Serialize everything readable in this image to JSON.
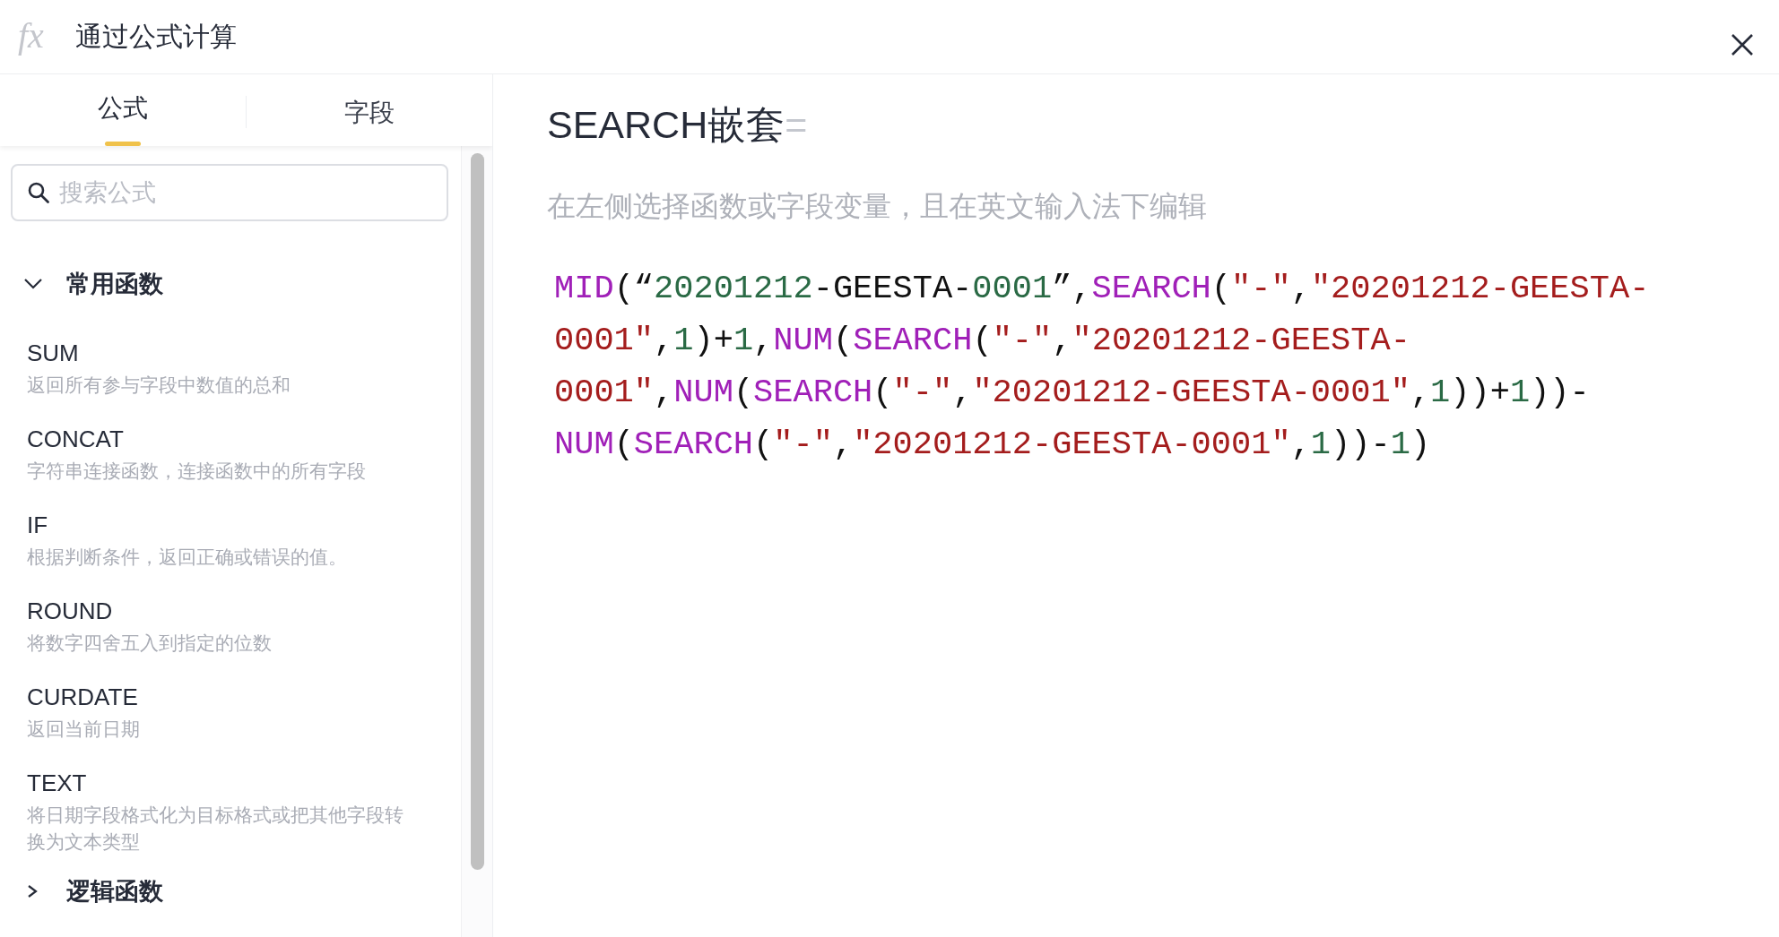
{
  "window": {
    "icon": "fx",
    "title": "通过公式计算"
  },
  "tabs": [
    {
      "label": "公式",
      "selected": true
    },
    {
      "label": "字段",
      "selected": false
    }
  ],
  "search": {
    "placeholder": "搜索公式"
  },
  "groups": [
    {
      "label": "常用函数",
      "expanded": true,
      "items": [
        {
          "name": "SUM",
          "description": "返回所有参与字段中数值的总和"
        },
        {
          "name": "CONCAT",
          "description": "字符串连接函数，连接函数中的所有字段"
        },
        {
          "name": "IF",
          "description": "根据判断条件，返回正确或错误的值。"
        },
        {
          "name": "ROUND",
          "description": "将数字四舍五入到指定的位数"
        },
        {
          "name": "CURDATE",
          "description": "返回当前日期"
        },
        {
          "name": "TEXT",
          "description": "将日期字段格式化为目标格式或把其他字段转换为文本类型"
        }
      ]
    },
    {
      "label": "逻辑函数",
      "expanded": false
    }
  ],
  "editor": {
    "title": "SEARCH嵌套",
    "title_suffix": "=",
    "hint": "在左侧选择函数或字段变量，且在英文输入法下编辑",
    "code_lines": [
      [
        {
          "kind": "fn",
          "text": "MID"
        },
        {
          "kind": "punct",
          "text": "(“"
        },
        {
          "kind": "num",
          "text": "20201212"
        },
        {
          "kind": "punct",
          "text": "-GEESTA-"
        },
        {
          "kind": "num",
          "text": "0001"
        },
        {
          "kind": "punct",
          "text": "”,"
        },
        {
          "kind": "fn",
          "text": "SEARCH"
        },
        {
          "kind": "punct",
          "text": "("
        },
        {
          "kind": "str",
          "text": "\"-\""
        },
        {
          "kind": "punct",
          "text": ","
        },
        {
          "kind": "str",
          "text": "\"20201212-GEESTA-"
        }
      ],
      [
        {
          "kind": "str",
          "text": "0001\""
        },
        {
          "kind": "punct",
          "text": ","
        },
        {
          "kind": "num",
          "text": "1"
        },
        {
          "kind": "punct",
          "text": ")+"
        },
        {
          "kind": "num",
          "text": "1"
        },
        {
          "kind": "punct",
          "text": ","
        },
        {
          "kind": "fn",
          "text": "NUM"
        },
        {
          "kind": "punct",
          "text": "("
        },
        {
          "kind": "fn",
          "text": "SEARCH"
        },
        {
          "kind": "punct",
          "text": "("
        },
        {
          "kind": "str",
          "text": "\"-\""
        },
        {
          "kind": "punct",
          "text": ","
        },
        {
          "kind": "str",
          "text": "\"20201212-GEESTA-"
        }
      ],
      [
        {
          "kind": "str",
          "text": "0001\""
        },
        {
          "kind": "punct",
          "text": ","
        },
        {
          "kind": "fn",
          "text": "NUM"
        },
        {
          "kind": "punct",
          "text": "("
        },
        {
          "kind": "fn",
          "text": "SEARCH"
        },
        {
          "kind": "punct",
          "text": "("
        },
        {
          "kind": "str",
          "text": "\"-\""
        },
        {
          "kind": "punct",
          "text": ","
        },
        {
          "kind": "str",
          "text": "\"20201212-GEESTA-0001\""
        },
        {
          "kind": "punct",
          "text": ","
        },
        {
          "kind": "num",
          "text": "1"
        },
        {
          "kind": "punct",
          "text": "))+"
        },
        {
          "kind": "num",
          "text": "1"
        },
        {
          "kind": "punct",
          "text": "))-"
        }
      ],
      [
        {
          "kind": "fn",
          "text": "NUM"
        },
        {
          "kind": "punct",
          "text": "("
        },
        {
          "kind": "fn",
          "text": "SEARCH"
        },
        {
          "kind": "punct",
          "text": "("
        },
        {
          "kind": "str",
          "text": "\"-\""
        },
        {
          "kind": "punct",
          "text": ","
        },
        {
          "kind": "str",
          "text": "\"20201212-GEESTA-0001\""
        },
        {
          "kind": "punct",
          "text": ","
        },
        {
          "kind": "num",
          "text": "1"
        },
        {
          "kind": "punct",
          "text": "))-"
        },
        {
          "kind": "num",
          "text": "1"
        },
        {
          "kind": "punct",
          "text": ")"
        }
      ]
    ]
  }
}
